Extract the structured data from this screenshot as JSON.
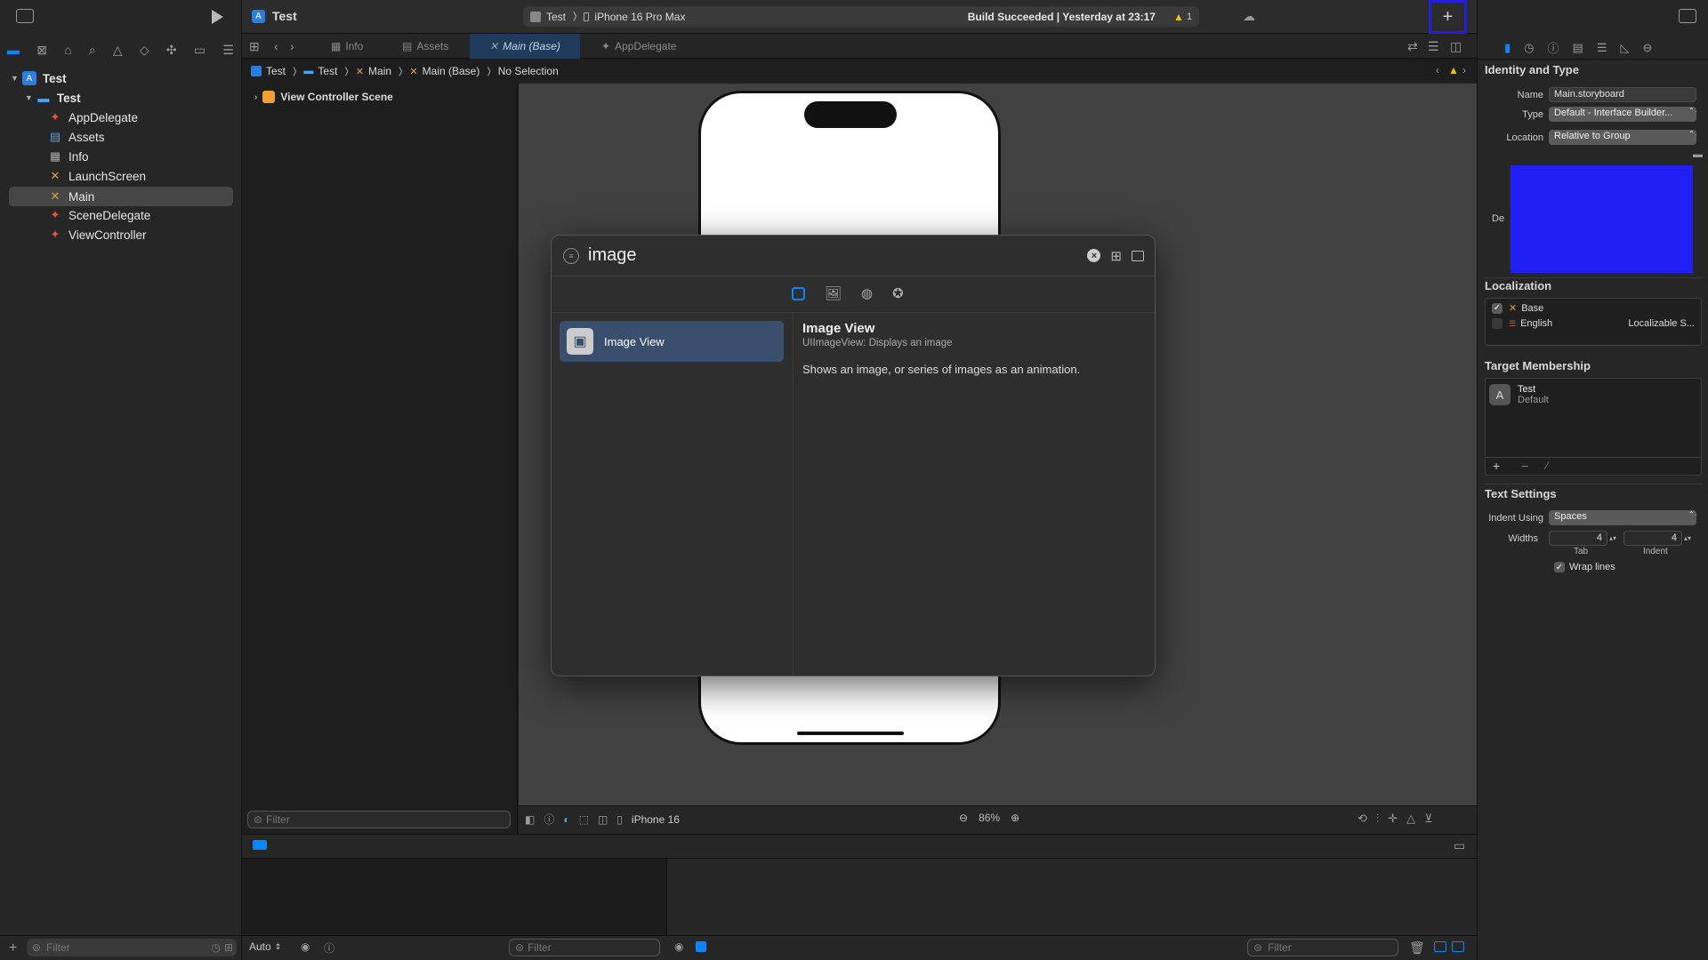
{
  "left": {
    "project_root": "Test",
    "group": "Test",
    "files": [
      "AppDelegate",
      "Assets",
      "Info",
      "LaunchScreen",
      "Main",
      "SceneDelegate",
      "ViewController"
    ],
    "filter_placeholder": "Filter"
  },
  "toolbar": {
    "project_title": "Test",
    "scheme": "Test",
    "device": "iPhone 16 Pro Max",
    "status": "Build Succeeded | Yesterday at 23:17",
    "warning_count": "1",
    "add_button": "+"
  },
  "tabs": [
    "Info",
    "Assets",
    "Main (Base)",
    "AppDelegate"
  ],
  "breadcrumb": [
    "Test",
    "Test",
    "Main",
    "Main (Base)",
    "No Selection"
  ],
  "outline": {
    "scene": "View Controller Scene",
    "filter_placeholder": "Filter"
  },
  "canvas": {
    "device_label": "iPhone 16",
    "zoom": "86%"
  },
  "library": {
    "search_value": "image",
    "result_label": "Image View",
    "detail_title": "Image View",
    "detail_subtitle": "UIImageView: Displays an image",
    "detail_description": "Shows an image, or series of images as an animation."
  },
  "debug": {
    "auto_label": "Auto",
    "filter_placeholder_1": "Filter",
    "filter_placeholder_2": "Filter"
  },
  "inspector": {
    "identity_title": "Identity and Type",
    "name_label": "Name",
    "name_value": "Main.storyboard",
    "type_label": "Type",
    "type_value": "Default - Interface Builder...",
    "location_label": "Location",
    "location_value": "Relative to Group",
    "partial_label": "De",
    "localization_title": "Localization",
    "loc_base": "Base",
    "loc_english": "English",
    "loc_english_value": "Localizable S...",
    "target_title": "Target Membership",
    "target_name": "Test",
    "target_sub": "Default",
    "text_settings_title": "Text Settings",
    "indent_using_label": "Indent Using",
    "indent_using_value": "Spaces",
    "widths_label": "Widths",
    "tab_value": "4",
    "indent_value": "4",
    "tab_label": "Tab",
    "indent_label": "Indent",
    "wrap_lines": "Wrap lines"
  },
  "colors": {
    "accent": "#0a84ff",
    "highlight_box": "#1f1fe0",
    "blue_preview": "#2020f5"
  }
}
